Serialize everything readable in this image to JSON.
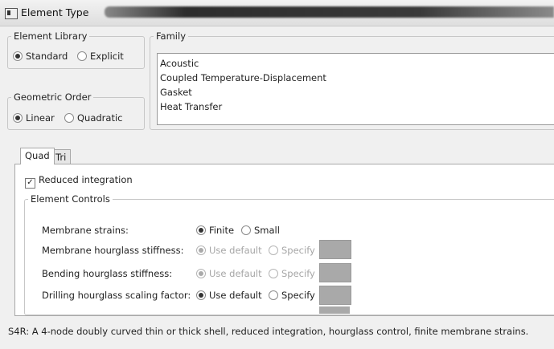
{
  "window": {
    "title": "Element Type"
  },
  "element_library": {
    "legend": "Element Library",
    "options": [
      {
        "label": "Standard",
        "selected": true
      },
      {
        "label": "Explicit",
        "selected": false
      }
    ]
  },
  "family": {
    "legend": "Family",
    "items": [
      "Acoustic",
      "Coupled Temperature-Displacement",
      "Gasket",
      "Heat Transfer"
    ]
  },
  "geometric_order": {
    "legend": "Geometric Order",
    "options": [
      {
        "label": "Linear",
        "selected": true
      },
      {
        "label": "Quadratic",
        "selected": false
      }
    ]
  },
  "tabs": [
    {
      "label": "Quad",
      "active": true
    },
    {
      "label": "Tri",
      "active": false
    }
  ],
  "reduced_integration": {
    "label": "Reduced integration",
    "checked": true
  },
  "element_controls": {
    "legend": "Element Controls",
    "rows": [
      {
        "label": "Membrane strains:",
        "opt1": "Finite",
        "opt2": "Small",
        "enabled": true
      },
      {
        "label": "Membrane hourglass stiffness:",
        "opt1": "Use default",
        "opt2": "Specify",
        "enabled": false
      },
      {
        "label": "Bending hourglass stiffness:",
        "opt1": "Use default",
        "opt2": "Specify",
        "enabled": false
      },
      {
        "label": "Drilling hourglass scaling factor:",
        "opt1": "Use default",
        "opt2": "Specify",
        "enabled": true
      }
    ]
  },
  "description": "S4R:  A 4-node doubly curved thin or thick shell, reduced integration, hourglass control, finite membrane strains."
}
